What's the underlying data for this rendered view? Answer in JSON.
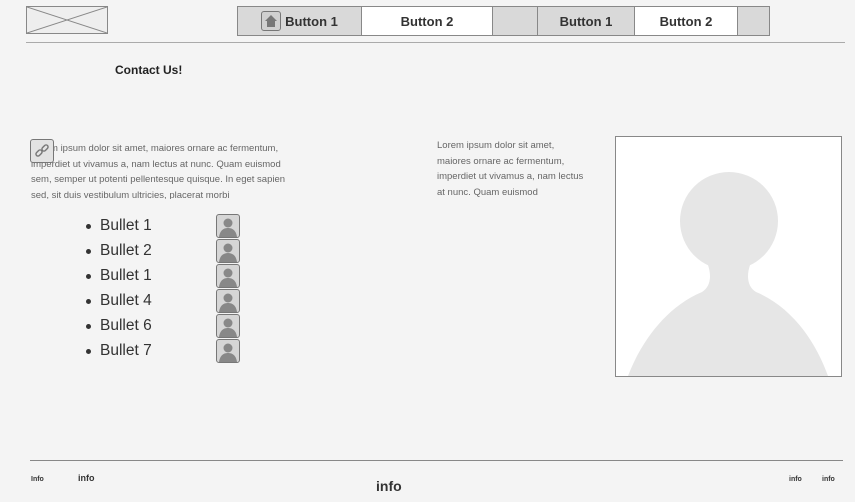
{
  "header": {
    "logo_icon": "placeholder-image-icon",
    "group1": {
      "home_icon": "home-icon",
      "button1": "Button 1",
      "button2": "Button 2"
    },
    "group2": {
      "button1": "Button 1",
      "button2": "Button 2"
    }
  },
  "main": {
    "contact_title": "Contact Us!",
    "link_icon": "link-icon",
    "paragraph_left": "Lorem ipsum dolor sit amet, maiores ornare ac fermentum, imperdiet ut vivamus a, nam lectus at nunc. Quam euismod sem, semper ut potenti pellentesque quisque. In eget sapien sed, sit duis vestibulum ultricies, placerat morbi",
    "paragraph_right": "Lorem ipsum dolor sit amet, maiores ornare ac fermentum, imperdiet ut vivamus a, nam lectus at nunc. Quam euismod",
    "bullets": [
      "Bullet 1",
      "Bullet 2",
      "Bullet 1",
      "Bullet 4",
      "Bullet 6",
      "Bullet 7"
    ],
    "avatar_icon": "user-avatar-icon",
    "photo_icon": "user-silhouette-placeholder"
  },
  "footer": {
    "info_left_1": "Info",
    "info_left_2": "info",
    "info_center": "info",
    "info_right_1": "info",
    "info_right_2": "info"
  }
}
